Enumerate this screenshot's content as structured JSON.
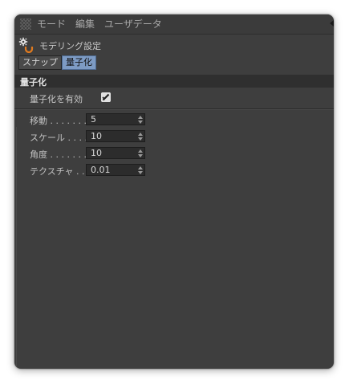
{
  "menubar": {
    "items": [
      "モード",
      "編集",
      "ユーザデータ"
    ]
  },
  "panel": {
    "title": "モデリング設定"
  },
  "tabs": [
    {
      "label": "スナップ",
      "active": false
    },
    {
      "label": "量子化",
      "active": true
    }
  ],
  "section": {
    "title": "量子化",
    "enable_label": "量子化を有効",
    "enable_checked": true
  },
  "fields": [
    {
      "label": "移動 . . . . . . . .",
      "value": "5"
    },
    {
      "label": "スケール . . . .",
      "value": "10"
    },
    {
      "label": "角度 . . . . . . . .",
      "value": "10"
    },
    {
      "label": "テクスチャ . .",
      "value": "0.01"
    }
  ],
  "colors": {
    "panel_bg": "#3e3e3e",
    "active_tab": "#7d9bc4",
    "header_bg": "#2f2f2f"
  }
}
